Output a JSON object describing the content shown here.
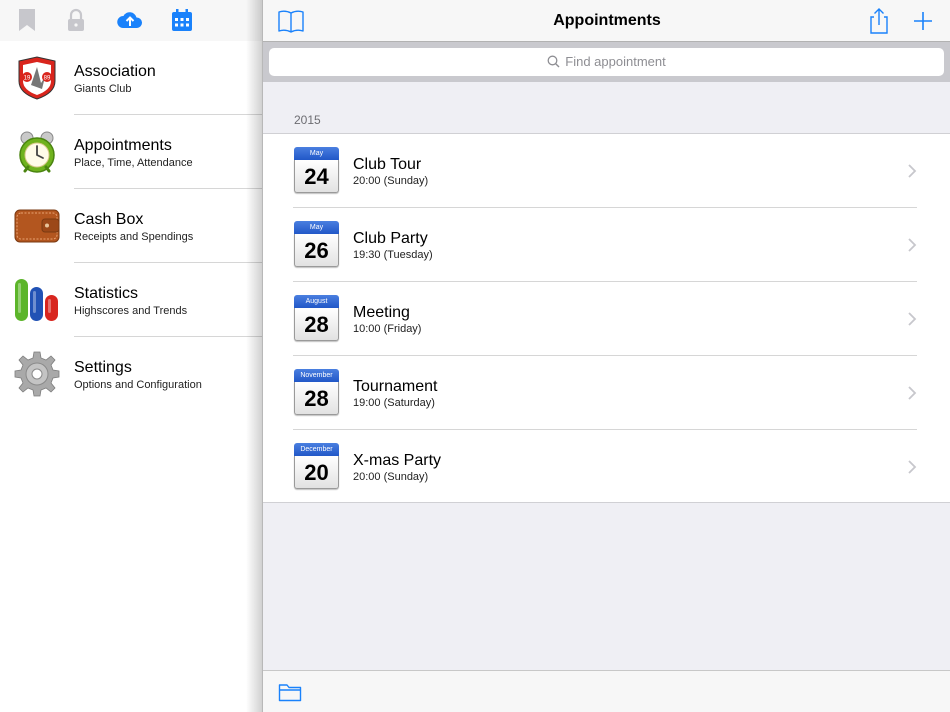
{
  "sidebar": {
    "toolbar_icons": [
      "bookmark-icon",
      "lock-icon",
      "cloud-upload-icon",
      "calendar-icon"
    ],
    "items": [
      {
        "title": "Association",
        "subtitle": "Giants Club",
        "icon": "club-logo-icon"
      },
      {
        "title": "Appointments",
        "subtitle": "Place, Time, Attendance",
        "icon": "alarm-clock-icon"
      },
      {
        "title": "Cash Box",
        "subtitle": "Receipts and Spendings",
        "icon": "wallet-icon"
      },
      {
        "title": "Statistics",
        "subtitle": "Highscores and Trends",
        "icon": "bar-chart-icon"
      },
      {
        "title": "Settings",
        "subtitle": "Options and Configuration",
        "icon": "gear-icon"
      }
    ],
    "logo_text": {
      "year_left": "19",
      "year_right": "89"
    }
  },
  "main": {
    "title": "Appointments",
    "search": {
      "placeholder": "Find appointment"
    },
    "section": "2015",
    "appointments": [
      {
        "month": "May",
        "day": "24",
        "title": "Club Tour",
        "time": "20:00 (Sunday)"
      },
      {
        "month": "May",
        "day": "26",
        "title": "Club Party",
        "time": "19:30 (Tuesday)"
      },
      {
        "month": "August",
        "day": "28",
        "title": "Meeting",
        "time": "10:00 (Friday)"
      },
      {
        "month": "November",
        "day": "28",
        "title": "Tournament",
        "time": "19:00 (Saturday)"
      },
      {
        "month": "December",
        "day": "20",
        "title": "X-mas Party",
        "time": "20:00 (Sunday)"
      }
    ]
  },
  "colors": {
    "accent": "#1a82fb",
    "toolbar_bg": "#f7f7f7",
    "group_bg": "#efeff4",
    "calendar_header": "#2b5fd0"
  }
}
